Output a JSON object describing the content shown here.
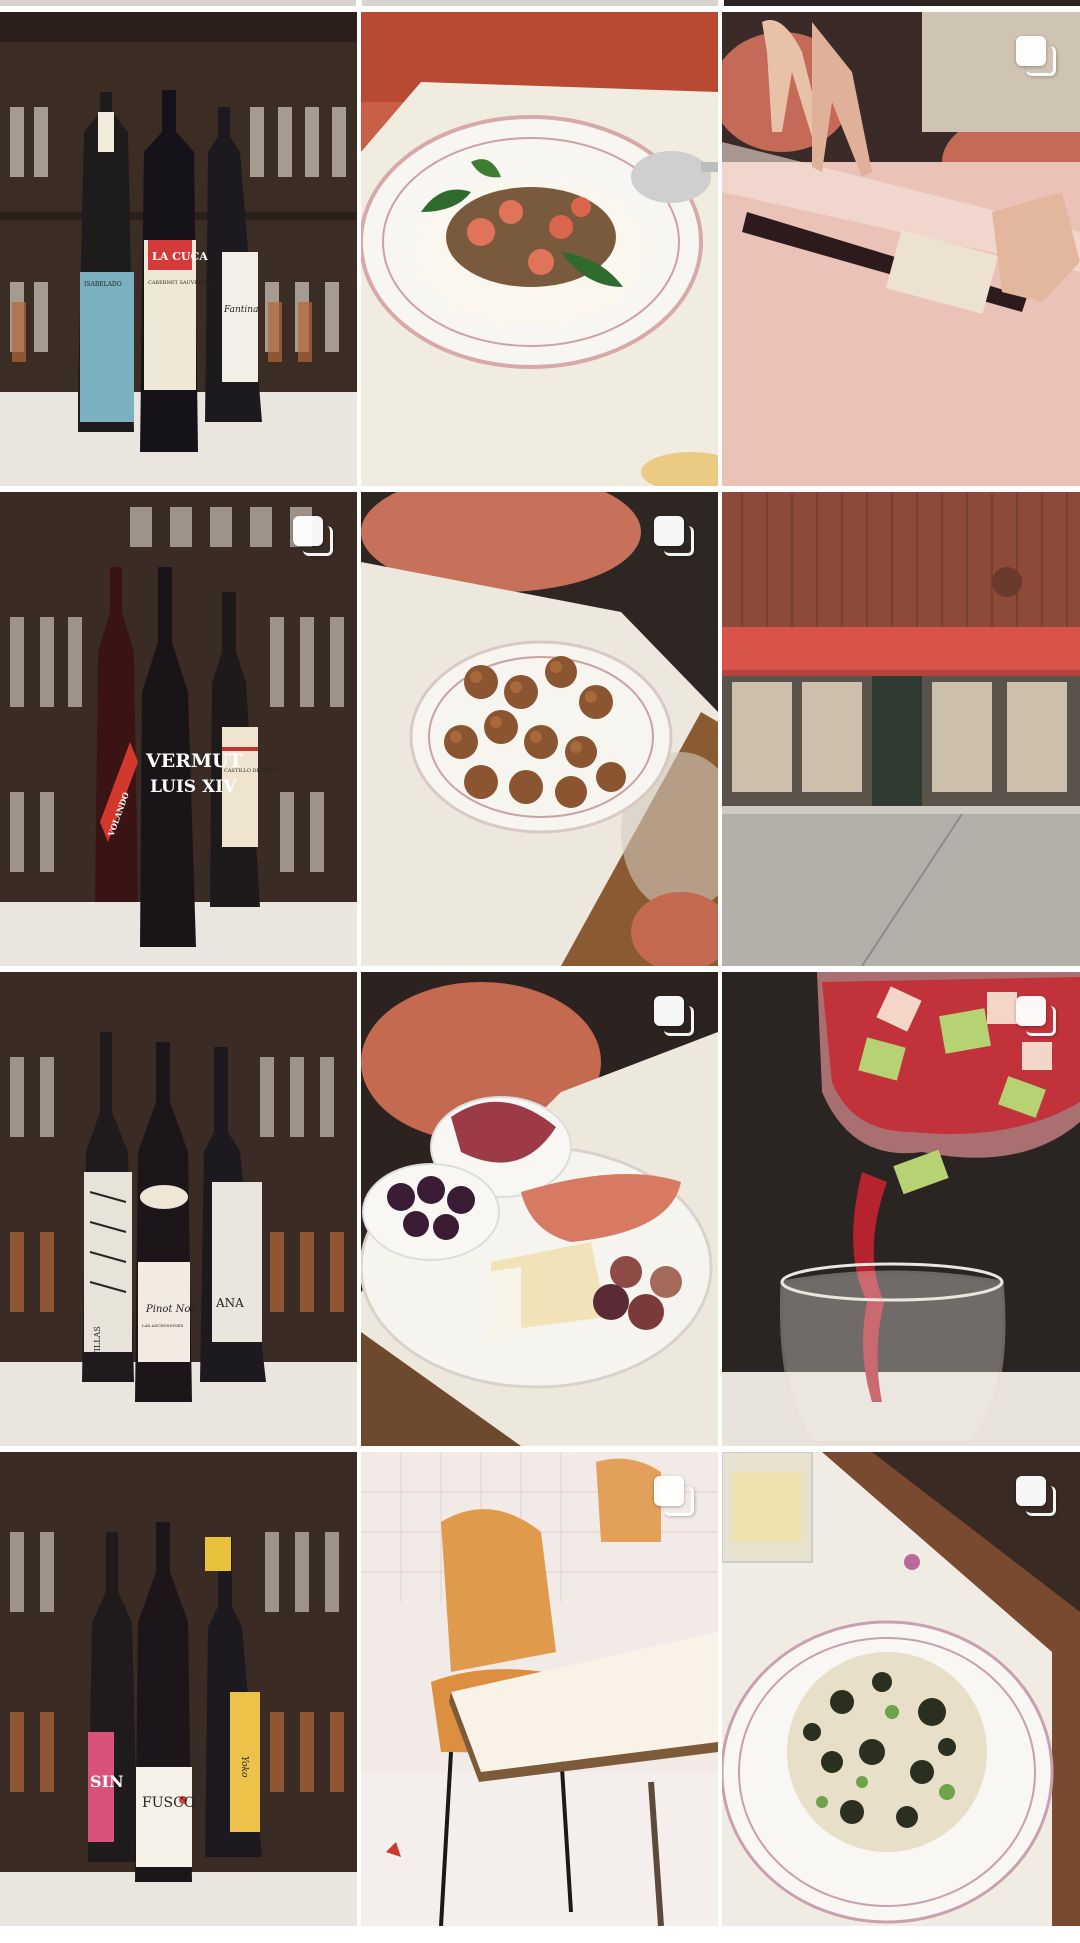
{
  "feed": {
    "posts": [
      {
        "name": "post-wine-bottles-trio",
        "carousel": false,
        "labels": [
          "LA CUCA",
          "CABERNET SAUVIGNON",
          "ISABELADO",
          "Fantina"
        ]
      },
      {
        "name": "post-burrata-dish",
        "carousel": false,
        "labels": []
      },
      {
        "name": "post-wine-pour-hands",
        "carousel": true,
        "labels": []
      },
      {
        "name": "post-vermut-bottles",
        "carousel": true,
        "labels": [
          "VERMUT",
          "LUIS XIV",
          "VOLANDO",
          "CASTILLO DE REYES"
        ]
      },
      {
        "name": "post-croquettes-plate",
        "carousel": true,
        "labels": []
      },
      {
        "name": "post-restaurant-facade",
        "carousel": false,
        "labels": []
      },
      {
        "name": "post-pinot-noir-bottles",
        "carousel": false,
        "labels": [
          "Pinot Noir",
          "LAS ASCENSIONES",
          "VILLAS",
          "ANA"
        ]
      },
      {
        "name": "post-charcuterie-board",
        "carousel": true,
        "labels": []
      },
      {
        "name": "post-sangria-pour",
        "carousel": true,
        "labels": []
      },
      {
        "name": "post-fusco-bottles",
        "carousel": false,
        "labels": [
          "FUSCO",
          "SIN",
          "Yoko"
        ]
      },
      {
        "name": "post-dining-chair-table",
        "carousel": true,
        "labels": []
      },
      {
        "name": "post-pasta-bowl",
        "carousel": true,
        "labels": []
      }
    ]
  },
  "icons": {
    "carousel": "multiple-images-icon"
  },
  "colors": {
    "background": "#ffffff",
    "wine_shelf": "#3b2c24",
    "table_pink": "#e7b8ae",
    "awning_red": "#d8544b"
  }
}
